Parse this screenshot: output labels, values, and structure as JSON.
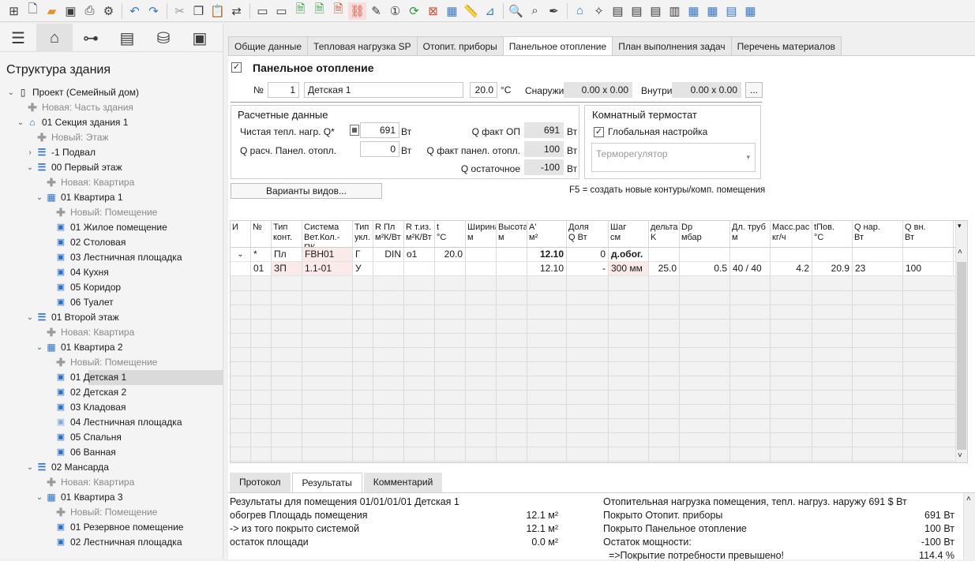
{
  "toolbar": {
    "icons": [
      "apps-icon",
      "new-file-icon",
      "open-folder-icon",
      "save-icon",
      "print-icon",
      "settings-icon",
      "undo-icon",
      "redo-icon",
      "cut-icon",
      "copy-icon",
      "paste-icon",
      "replace-icon",
      "window-icon",
      "window2-icon",
      "export-icon",
      "export-green-icon",
      "export-red-icon",
      "link-icon",
      "pencil-icon",
      "numbering-icon",
      "refresh-icon",
      "delete-icon",
      "grid-icon",
      "ruler-icon",
      "measure-icon",
      "zoom-icon",
      "search-plus-icon",
      "eyedropper-icon",
      "house-icon",
      "wand-icon",
      "form-icon",
      "form-edit-icon",
      "form-list-icon",
      "form-select-icon",
      "table-icon",
      "table2-icon",
      "table3-icon",
      "table4-icon"
    ]
  },
  "left": {
    "title": "Структура здания"
  },
  "tree": [
    {
      "label": "Проект (Семейный дом)",
      "lvl": 0,
      "tog": "⌄",
      "icon": "project",
      "grey": false
    },
    {
      "label": "Новая: Часть здания",
      "lvl": 1,
      "tog": "",
      "icon": "plus",
      "grey": true
    },
    {
      "label": "01 Секция здания 1",
      "lvl": 1,
      "tog": "⌄",
      "icon": "house",
      "grey": false
    },
    {
      "label": "Новый: Этаж",
      "lvl": 2,
      "tog": "",
      "icon": "plus",
      "grey": true
    },
    {
      "label": "-1 Подвал",
      "lvl": 2,
      "tog": "›",
      "icon": "level",
      "grey": false
    },
    {
      "label": "00 Первый этаж",
      "lvl": 2,
      "tog": "⌄",
      "icon": "level",
      "grey": false
    },
    {
      "label": "Новая: Квартира",
      "lvl": 3,
      "tog": "",
      "icon": "plus",
      "grey": true
    },
    {
      "label": "01 Квартира 1",
      "lvl": 3,
      "tog": "⌄",
      "icon": "building",
      "grey": false
    },
    {
      "label": "Новый: Помещение",
      "lvl": 4,
      "tog": "",
      "icon": "plus",
      "grey": true
    },
    {
      "label": "01 Жилое помещение",
      "lvl": 4,
      "tog": "",
      "icon": "room",
      "grey": false
    },
    {
      "label": "02 Столовая",
      "lvl": 4,
      "tog": "",
      "icon": "room",
      "grey": false
    },
    {
      "label": "03 Лестничная площадка",
      "lvl": 4,
      "tog": "",
      "icon": "room",
      "grey": false
    },
    {
      "label": "04 Кухня",
      "lvl": 4,
      "tog": "",
      "icon": "room",
      "grey": false
    },
    {
      "label": "05 Коридор",
      "lvl": 4,
      "tog": "",
      "icon": "room",
      "grey": false
    },
    {
      "label": "06 Туалет",
      "lvl": 4,
      "tog": "",
      "icon": "room",
      "grey": false
    },
    {
      "label": "01 Второй этаж",
      "lvl": 2,
      "tog": "⌄",
      "icon": "level",
      "grey": false
    },
    {
      "label": "Новая: Квартира",
      "lvl": 3,
      "tog": "",
      "icon": "plus",
      "grey": true
    },
    {
      "label": "01 Квартира 2",
      "lvl": 3,
      "tog": "⌄",
      "icon": "building",
      "grey": false
    },
    {
      "label": "Новый: Помещение",
      "lvl": 4,
      "tog": "",
      "icon": "plus",
      "grey": true
    },
    {
      "label": "01 Детская 1",
      "lvl": 4,
      "tog": "",
      "icon": "room",
      "grey": false,
      "sel": true
    },
    {
      "label": "02 Детская 2",
      "lvl": 4,
      "tog": "",
      "icon": "room",
      "grey": false
    },
    {
      "label": "03 Кладовая",
      "lvl": 4,
      "tog": "",
      "icon": "room",
      "grey": false
    },
    {
      "label": "04 Лестничная площадка",
      "lvl": 4,
      "tog": "",
      "icon": "room-light",
      "grey": false
    },
    {
      "label": "05 Спальня",
      "lvl": 4,
      "tog": "",
      "icon": "room",
      "grey": false
    },
    {
      "label": "06 Ванная",
      "lvl": 4,
      "tog": "",
      "icon": "room",
      "grey": false
    },
    {
      "label": "02 Мансарда",
      "lvl": 2,
      "tog": "⌄",
      "icon": "level",
      "grey": false
    },
    {
      "label": "Новая: Квартира",
      "lvl": 3,
      "tog": "",
      "icon": "plus",
      "grey": true
    },
    {
      "label": "01 Квартира 3",
      "lvl": 3,
      "tog": "⌄",
      "icon": "building",
      "grey": false
    },
    {
      "label": "Новый: Помещение",
      "lvl": 4,
      "tog": "",
      "icon": "plus",
      "grey": true
    },
    {
      "label": "01 Резервное помещение",
      "lvl": 4,
      "tog": "",
      "icon": "room",
      "grey": false
    },
    {
      "label": "02 Лестничная площадка",
      "lvl": 4,
      "tog": "",
      "icon": "room",
      "grey": false
    }
  ],
  "tabs": [
    "Общие данные",
    "Тепловая нагрузка SP",
    "Отопит. приборы",
    "Панельное отопление",
    "План выполнения задач",
    "Перечень материалов"
  ],
  "header": {
    "title": "Панельное отопление",
    "no_label": "№",
    "no_value": "1",
    "room_name": "Детская 1",
    "temp": "20.0",
    "temp_unit": "°C",
    "outside_label": "Снаружи",
    "outside_value": "0.00 x 0.00",
    "inside_label": "Внутри",
    "inside_value": "0.00 x 0.00",
    "more_btn": "..."
  },
  "calc": {
    "title": "Расчетные данные",
    "net_label": "Чистая тепл. нагр. Q*",
    "net_value": "691",
    "unit": "Вт",
    "rasch_label": "Q расч. Панел. отопл.",
    "rasch_value": "0",
    "fact_op_label": "Q факт ОП",
    "fact_op_value": "691",
    "fact_panel_label": "Q факт панел. отопл.",
    "fact_panel_value": "100",
    "ost_label": "Q остаточное",
    "ost_value": "-100"
  },
  "thermo": {
    "title": "Комнатный термостат",
    "global_label": "Глобальная настройка",
    "select_placeholder": "Терморегулятор"
  },
  "variants_btn": "Варианты видов...",
  "f5_hint": "F5 = создать новые контуры/комп. помещения",
  "grid": {
    "headers": [
      "И",
      "№",
      "Тип\nконт.",
      "Система\nВет.Кол.-ПК",
      "Тип\nукл.",
      "R Пл\nм²К/Вт",
      "R т.из.\nм²К/Вт",
      "t\n°C",
      "Ширина\nм",
      "Высота\nм",
      "A'\nм²",
      "Доля\nQ Вт",
      "Шаг\nсм",
      "дельта\nK",
      "Dp\nмбар",
      "Дл. труб\nм",
      "Масс.рас\nкг/ч",
      "tПов.\n°C",
      "Q нар.\nВт",
      "Q вн.\nВт"
    ],
    "rows": [
      [
        "⌄",
        "*",
        "Пл",
        "FBH01",
        "Г",
        "DIN",
        "о1",
        "20.0",
        "",
        "",
        "12.10",
        "0",
        "д.обог.",
        "",
        "",
        "",
        "",
        "",
        "",
        ""
      ],
      [
        "",
        "01",
        "ЗП",
        "1.1-01",
        "У",
        "",
        "",
        "",
        "",
        "",
        "12.10",
        "-",
        "300 мм",
        "25.0",
        "0.5",
        "40 / 40",
        "4.2",
        "20.9",
        "23",
        "100"
      ]
    ]
  },
  "bottom_tabs": [
    "Протокол",
    "Результаты",
    "Комментарий"
  ],
  "results": {
    "left_title": "Результаты для помещения 01/01/01/01 Детская 1",
    "left": [
      {
        "label": "обогрев Площадь помещения",
        "value": "12.1 м²"
      },
      {
        "label": " -> из того покрыто системой",
        "value": "12.1 м²"
      },
      {
        "label": "остаток площади",
        "value": "0.0 м²"
      }
    ],
    "right_title": "Отопительная нагрузка помещения, тепл. нагруз. наружу 691 $ Вт",
    "right": [
      {
        "label": "Покрыто Отопит. приборы",
        "value": "691 Вт"
      },
      {
        "label": "Покрыто Панельное отопление",
        "value": "100 Вт"
      },
      {
        "label": "Остаток мощности:",
        "value": "-100 Вт"
      },
      {
        "label": "  =>Покрытие потребности превышено!",
        "value": "114.4 %"
      }
    ]
  }
}
